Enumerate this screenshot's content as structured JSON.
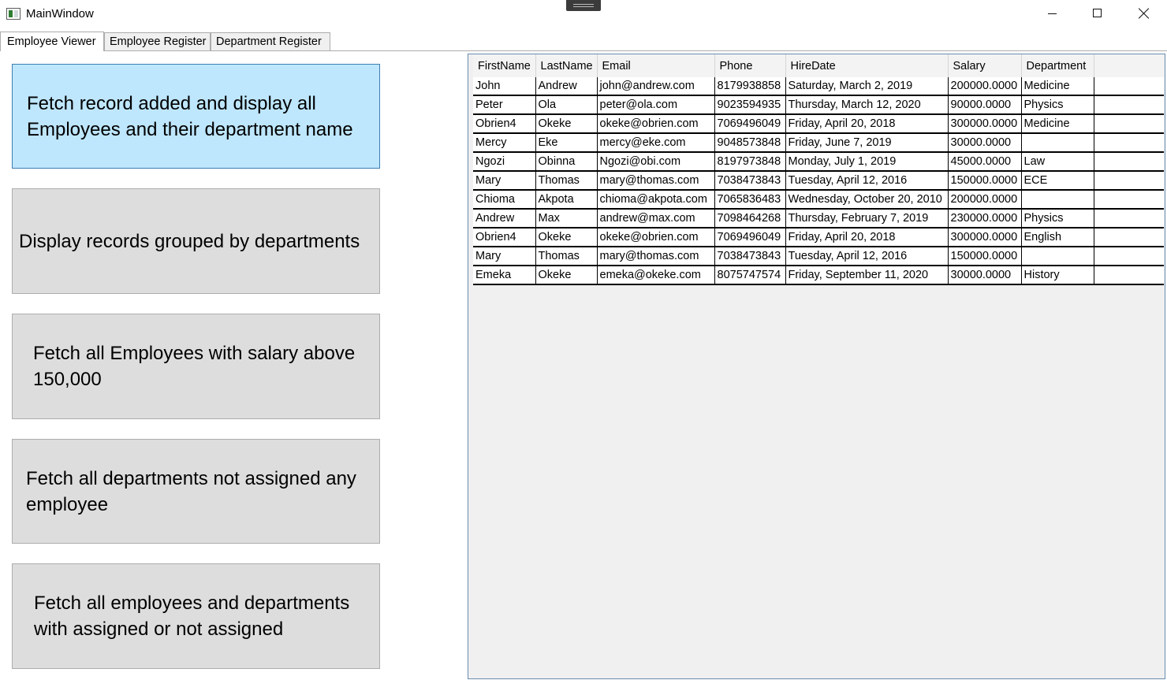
{
  "window": {
    "title": "MainWindow"
  },
  "tabs": [
    {
      "label": "Employee Viewer",
      "selected": true
    },
    {
      "label": "Employee Register",
      "selected": false
    },
    {
      "label": "Department Register",
      "selected": false
    }
  ],
  "actions": [
    {
      "label": "Fetch record added and display all Employees and their department name"
    },
    {
      "label": "Display records grouped by departments"
    },
    {
      "label": "Fetch all Employees with salary above 150,000"
    },
    {
      "label": "Fetch all departments not assigned any employee"
    },
    {
      "label": "Fetch all employees and departments with assigned or not assigned"
    }
  ],
  "grid": {
    "columns": [
      "FirstName",
      "LastName",
      "Email",
      "Phone",
      "HireDate",
      "Salary",
      "Department"
    ],
    "rows": [
      [
        "John",
        "Andrew",
        "john@andrew.com",
        "8179938858",
        "Saturday, March 2, 2019",
        "200000.0000",
        "Medicine"
      ],
      [
        "Peter",
        "Ola",
        "peter@ola.com",
        "9023594935",
        "Thursday, March 12, 2020",
        "90000.0000",
        "Physics"
      ],
      [
        "Obrien4",
        "Okeke",
        "okeke@obrien.com",
        "7069496049",
        "Friday, April 20, 2018",
        "300000.0000",
        "Medicine"
      ],
      [
        "Mercy",
        "Eke",
        "mercy@eke.com",
        "9048573848",
        "Friday, June 7, 2019",
        "30000.0000",
        ""
      ],
      [
        "Ngozi",
        "Obinna",
        "Ngozi@obi.com",
        "8197973848",
        "Monday, July 1, 2019",
        "45000.0000",
        "Law"
      ],
      [
        "Mary",
        "Thomas",
        "mary@thomas.com",
        "7038473843",
        "Tuesday, April 12, 2016",
        "150000.0000",
        "ECE"
      ],
      [
        "Chioma",
        "Akpota",
        "chioma@akpota.com",
        "7065836483",
        "Wednesday, October 20, 2010",
        "200000.0000",
        ""
      ],
      [
        "Andrew",
        "Max",
        "andrew@max.com",
        "7098464268",
        "Thursday, February 7, 2019",
        "230000.0000",
        "Physics"
      ],
      [
        "Obrien4",
        "Okeke",
        "okeke@obrien.com",
        "7069496049",
        "Friday, April 20, 2018",
        "300000.0000",
        "English"
      ],
      [
        "Mary",
        "Thomas",
        "mary@thomas.com",
        "7038473843",
        "Tuesday, April 12, 2016",
        "150000.0000",
        ""
      ],
      [
        "Emeka",
        "Okeke",
        "emeka@okeke.com",
        "8075747574",
        "Friday, September 11, 2020",
        "30000.0000",
        "History"
      ]
    ]
  }
}
